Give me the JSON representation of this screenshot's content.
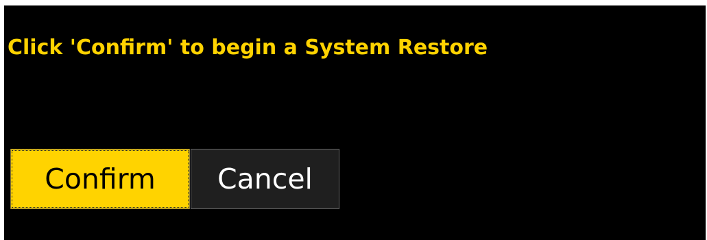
{
  "dialog": {
    "prompt": "Click 'Confirm' to begin a System Restore",
    "confirm_label": "Confirm",
    "cancel_label": "Cancel"
  },
  "colors": {
    "background": "#000000",
    "prompt_text": "#FFD300",
    "confirm_bg": "#FFD300",
    "confirm_text": "#000000",
    "cancel_bg": "#1F1F1F",
    "cancel_text": "#FFFFFF"
  }
}
